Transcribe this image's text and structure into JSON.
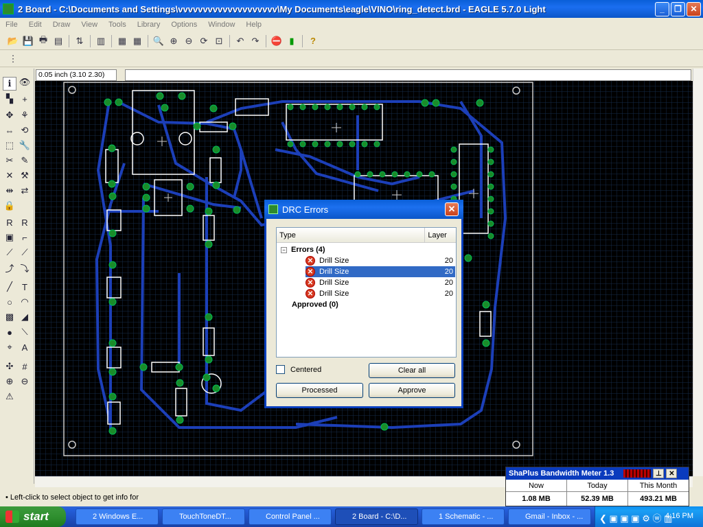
{
  "window": {
    "title": "2 Board - C:\\Documents and Settings\\vvvvvvvvvvvvvvvvvvvv\\My Documents\\eagle\\VINO\\ring_detect.brd - EAGLE 5.7.0 Light"
  },
  "menu": [
    "File",
    "Edit",
    "Draw",
    "View",
    "Tools",
    "Library",
    "Options",
    "Window",
    "Help"
  ],
  "coord_display": "0.05 inch (3.10 2.30)",
  "status_text": "Left-click to select object to get info for",
  "drc": {
    "title": "DRC Errors",
    "col_type": "Type",
    "col_layer": "Layer",
    "errors_group": "Errors (4)",
    "errors": [
      {
        "label": "Drill Size",
        "layer": "20",
        "selected": false
      },
      {
        "label": "Drill Size",
        "layer": "20",
        "selected": true
      },
      {
        "label": "Drill Size",
        "layer": "20",
        "selected": false
      },
      {
        "label": "Drill Size",
        "layer": "20",
        "selected": false
      }
    ],
    "approved_group": "Approved (0)",
    "centered_label": "Centered",
    "clear_all": "Clear all",
    "processed": "Processed",
    "approve": "Approve"
  },
  "bandwidth": {
    "title": "ShaPlus Bandwidth Meter 1.3",
    "cols": [
      {
        "label": "Now",
        "value": "1.08 MB"
      },
      {
        "label": "Today",
        "value": "52.39 MB"
      },
      {
        "label": "This Month",
        "value": "493.21 MB"
      }
    ]
  },
  "taskbar": {
    "start": "start",
    "tasks": [
      {
        "label": "2 Windows E...",
        "active": false
      },
      {
        "label": "TouchToneDT...",
        "active": false
      },
      {
        "label": "Control Panel ...",
        "active": false
      },
      {
        "label": "2 Board - C:\\D...",
        "active": true
      },
      {
        "label": "1 Schematic - ...",
        "active": false
      },
      {
        "label": "Gmail - Inbox - ...",
        "active": false
      }
    ],
    "clock": "4:16 PM"
  }
}
